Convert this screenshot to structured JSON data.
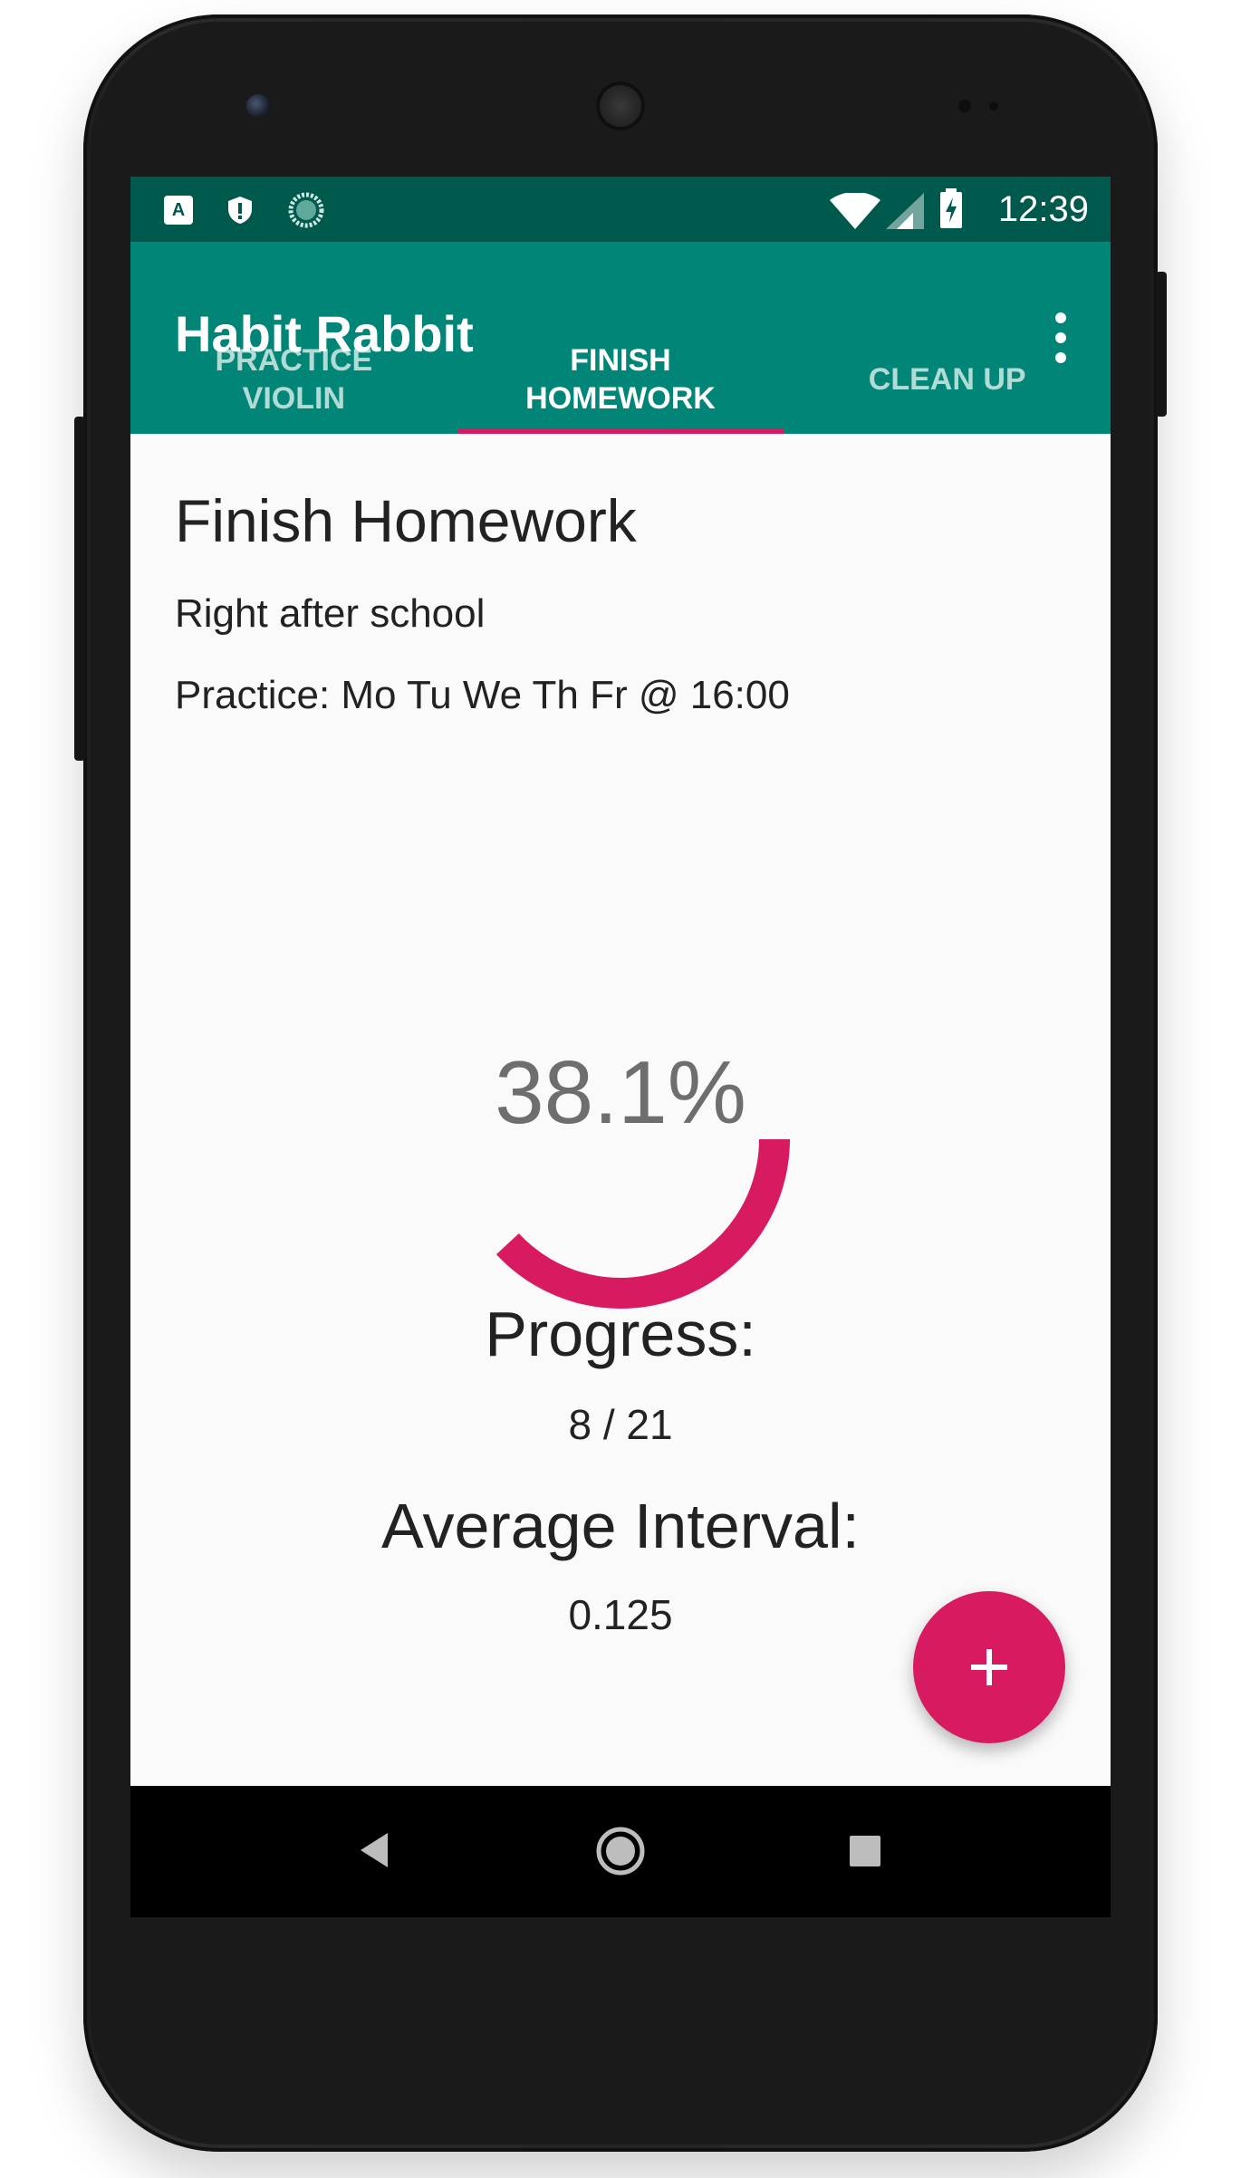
{
  "status_bar": {
    "time": "12:39",
    "icons": [
      "a-app-icon",
      "shield-icon",
      "sync-icon",
      "wifi-icon",
      "signal-icon",
      "battery-charging-icon"
    ]
  },
  "app_bar": {
    "title": "Habit Rabbit",
    "menu_icon": "more-vert-icon"
  },
  "tabs": [
    {
      "label": "PRACTICE\nVIOLIN",
      "active": false
    },
    {
      "label": "FINISH\nHOMEWORK",
      "active": true
    },
    {
      "label": "CLEAN UP",
      "active": false
    }
  ],
  "habit": {
    "title": "Finish Homework",
    "description": "Right after school",
    "schedule": "Practice: Mo Tu We Th Fr @ 16:00"
  },
  "progress_gauge": {
    "label": "38.1%",
    "fraction": 0.381
  },
  "stats": {
    "progress_label": "Progress:",
    "progress_value": "8 / 21",
    "interval_label": "Average Interval:",
    "interval_value": "0.125"
  },
  "fab": {
    "icon": "plus-icon"
  },
  "nav_bar": {
    "icons": [
      "back-icon",
      "home-icon",
      "recents-icon"
    ]
  },
  "colors": {
    "status_bar": "#00594d",
    "app_bar": "#018577",
    "accent": "#d81b60",
    "background": "#fafafa"
  }
}
